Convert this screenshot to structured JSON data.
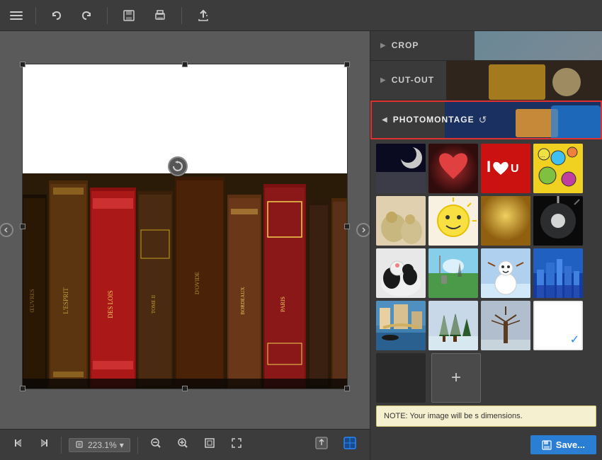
{
  "toolbar": {
    "undo_label": "↩",
    "redo_label": "↪",
    "save_icon": "💾",
    "print_icon": "🖨",
    "export_icon": "↑",
    "menu_icon": "☰"
  },
  "canvas": {
    "zoom_value": "223.1%",
    "zoom_dropdown": "▾"
  },
  "right_panel": {
    "crop": {
      "label": "CROP",
      "arrow": "▶"
    },
    "cutout": {
      "label": "CUT-OUT",
      "arrow": "▶"
    },
    "photomontage": {
      "label": "PHOTOMONTAGE",
      "arrow": "◀",
      "reset_icon": "↺"
    }
  },
  "thumbnails": {
    "row1": [
      "moon",
      "heart-tree",
      "i-love",
      "cartoon"
    ],
    "row2": [
      "cats",
      "sun-face",
      "golden",
      "dark-flash"
    ],
    "row3": [
      "cow",
      "landscape",
      "snowman",
      "city"
    ],
    "row4": [
      "venice",
      "snow-trees",
      "winter-tree",
      "blank"
    ]
  },
  "tooltip": {
    "text": "NOTE: Your image will be s dimensions."
  },
  "save_button": {
    "label": "Save..."
  },
  "bottom_bar": {
    "zoom": "223.1%",
    "zoom_arrow": "▾"
  }
}
